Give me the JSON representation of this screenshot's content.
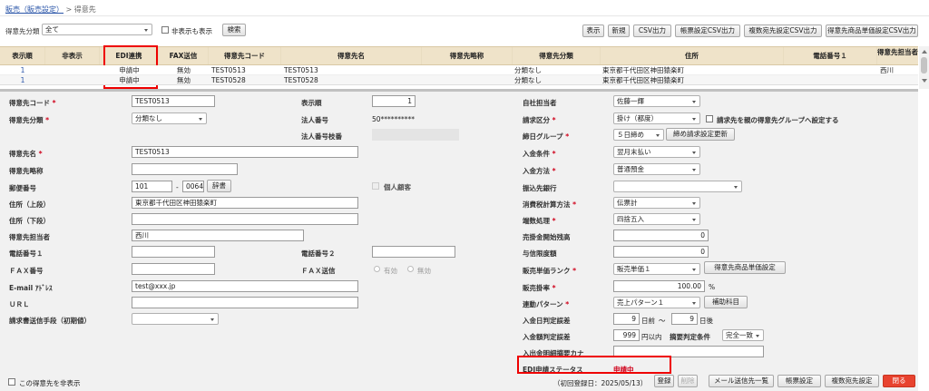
{
  "breadcrumb": {
    "parent": "販売（販売設定）",
    "separator": ">",
    "current": "得意先"
  },
  "filter": {
    "category_label": "得意先分類",
    "category_value": "全て",
    "show_hidden_label": "非表示も表示",
    "search_button": "検索"
  },
  "toolbar": [
    "表示",
    "新規",
    "CSV出力",
    "帳票設定CSV出力",
    "複数宛先設定CSV出力",
    "得意先商品単価設定CSV出力"
  ],
  "grid": {
    "columns": [
      "表示順",
      "非表示",
      "EDI連携",
      "FAX送信",
      "得意先コード",
      "得意先名",
      "得意先略称",
      "得意先分類",
      "住所",
      "電話番号１",
      "得意先担当者"
    ],
    "rows": [
      [
        "1",
        "",
        "申請中",
        "無効",
        "TEST0513",
        "TEST0513",
        "",
        "分類なし",
        "東京都千代田区神田猿楽町",
        "",
        "西川"
      ],
      [
        "1",
        "",
        "申請中",
        "無効",
        "TEST0528",
        "TEST0528",
        "",
        "分類なし",
        "東京都千代田区神田猿楽町",
        "",
        ""
      ]
    ]
  },
  "form": {
    "code_label": "得意先コード",
    "code_value": "TEST0513",
    "order_label": "表示順",
    "order_value": "1",
    "staff_label": "自社担当者",
    "staff_value": "佐藤一輝",
    "cat_label": "得意先分類",
    "cat_value": "分類なし",
    "corp_label": "法人番号",
    "corp_value": "50**********",
    "billing_label": "請求区分",
    "billing_value": "掛け（都度）",
    "billing_check": "請求先を親の得意先グループへ設定する",
    "corpbranch_label": "法人番号枝番",
    "closing_label": "締日グループ",
    "closing_value": "５日締め",
    "closing_btn": "締め請求設定更新",
    "name_label": "得意先名",
    "name_value": "TEST0513",
    "payterm_label": "入金条件",
    "payterm_value": "翌月末払い",
    "abbr_label": "得意先略称",
    "paymethod_label": "入金方法",
    "paymethod_value": "普通預金",
    "zip_label": "郵便番号",
    "zip1": "101",
    "zip_dash": "-",
    "zip2": "0064",
    "dict_btn": "辞書",
    "individual_label": "個人顧客",
    "bank_label": "振込先銀行",
    "addr1_label": "住所（上段）",
    "addr1_value": "東京都千代田区神田猿楽町",
    "tax_label": "消費税計算方法",
    "tax_value": "伝票計",
    "addr2_label": "住所（下段）",
    "round_label": "端数処理",
    "round_value": "四捨五入",
    "person_label": "得意先担当者",
    "person_value": "西川",
    "opening_label": "売掛金開始残高",
    "opening_value": "0",
    "tel1_label": "電話番号１",
    "tel2_label": "電話番号２",
    "credit_label": "与信限度額",
    "credit_value": "0",
    "fax_label": "ＦＡＸ番号",
    "faxsend_label": "ＦＡＸ送信",
    "fax_on": "有効",
    "fax_off": "無効",
    "rank_label": "販売単価ランク",
    "rank_value": "販売単価１",
    "rank_btn": "得意先商品単価設定",
    "email_label": "E-mail ｱﾄﾞﾚｽ",
    "email_value": "test@xxx.jp",
    "rate_label": "販売掛率",
    "rate_value": "100.00",
    "rate_unit": "%",
    "url_label": "ＵＲＬ",
    "pattern_label": "連動パターン",
    "pattern_value": "売上パターン１",
    "pattern_btn": "補助科目",
    "send_label": "請求書送信手段（初期値）",
    "payday_label": "入金日判定誤差",
    "payday_before": "9",
    "payday_before_unit": "日前",
    "payday_tilde": "～",
    "payday_after": "9",
    "payday_after_unit": "日後",
    "payamt_label": "入金額判定誤差",
    "payamt_value": "999",
    "payamt_unit": "円以内",
    "summary_label": "摘要判定条件",
    "summary_value": "完全一致",
    "kana_label": "入出金明細摘要カナ",
    "edi_label": "EDI申請ステータス",
    "edi_value": "申請中",
    "hide_label": "この得意先を非表示",
    "created": "（初回登録日：2025/05/13）"
  },
  "bottom_buttons": [
    "登録",
    "削除",
    "メール送信先一覧",
    "帳票設定",
    "複数宛先設定",
    "閉る"
  ],
  "colors": {
    "accent_red": "#d0021b",
    "grid_header": "#efe3c9",
    "close_button": "#e8432f"
  }
}
